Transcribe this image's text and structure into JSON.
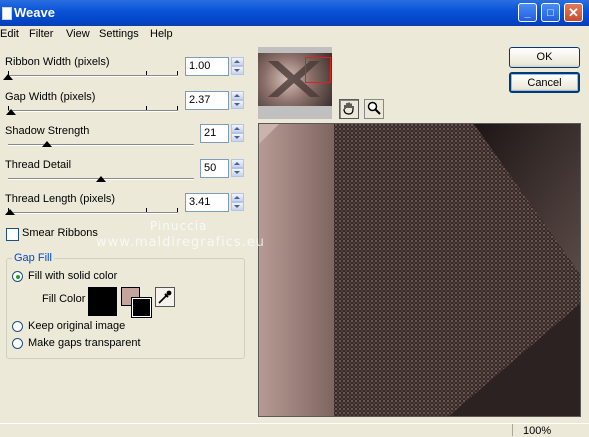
{
  "window": {
    "title": "Weave"
  },
  "menu": [
    "Edit",
    "Filter",
    "View",
    "Settings",
    "Help"
  ],
  "controls": {
    "ribbon_width": {
      "label": "Ribbon Width (pixels)",
      "value": "1.00",
      "level": 0.0
    },
    "gap_width": {
      "label": "Gap Width (pixels)",
      "value": "2.37",
      "level": 0.02
    },
    "shadow_strength": {
      "label": "Shadow Strength",
      "value": "21",
      "level": 0.21
    },
    "thread_detail": {
      "label": "Thread Detail",
      "value": "50",
      "level": 0.5
    },
    "thread_length": {
      "label": "Thread Length (pixels)",
      "value": "3.41",
      "level": 0.01
    }
  },
  "smear_ribbons": {
    "label": "Smear Ribbons",
    "checked": false
  },
  "gap_fill": {
    "legend": "Gap Fill",
    "options": [
      "Fill with solid color",
      "Keep original image",
      "Make gaps transparent"
    ],
    "selected": 0,
    "fill_color_label": "Fill Color",
    "fill_color": "#000000",
    "swatch_bg": "#c4a59e",
    "swatch_fg": "#000000"
  },
  "buttons": {
    "ok": "OK",
    "cancel": "Cancel"
  },
  "status": {
    "zoom": "100%"
  },
  "watermark": {
    "line1": "Pinuccia",
    "line2": "www.maldiregrafics.eu"
  },
  "icons": {
    "pan": "hand-icon",
    "zoom": "magnifier-icon",
    "eyedropper": "eyedropper-icon"
  }
}
